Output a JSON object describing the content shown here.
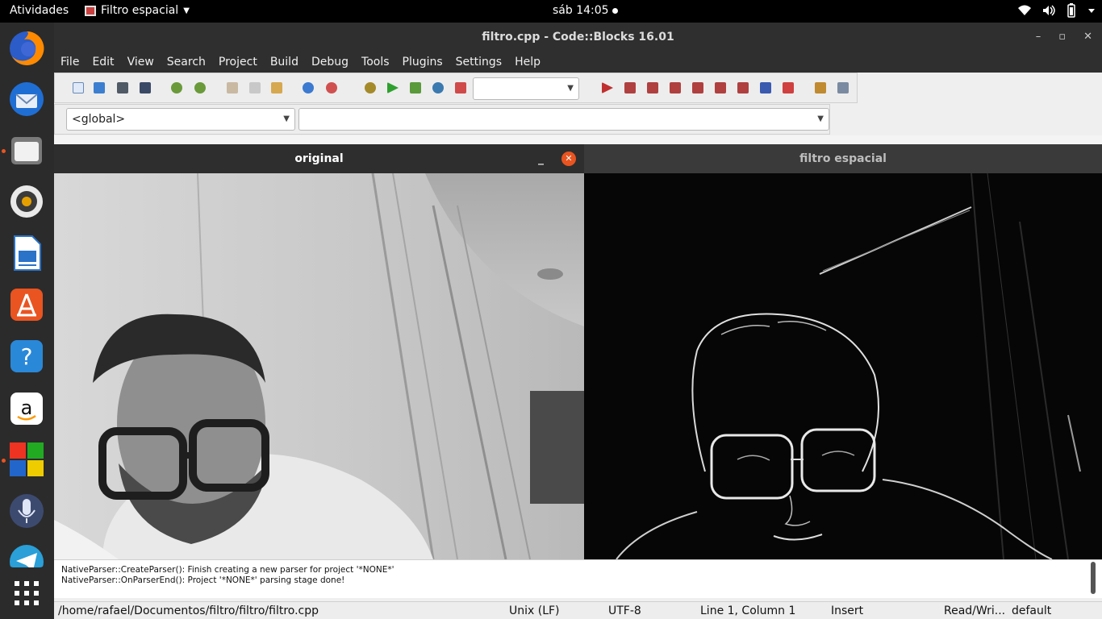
{
  "topbar": {
    "activities": "Atividades",
    "app_name": "Filtro espacial",
    "clock": "sáb 14:05"
  },
  "dock": {
    "items": [
      "firefox-icon",
      "thunderbird-icon",
      "files-icon",
      "rhythmbox-icon",
      "writer-icon",
      "software-icon",
      "help-icon",
      "amazon-icon",
      "codeblocks-icon",
      "voice-icon",
      "telegram-icon",
      "apps-grid-icon"
    ]
  },
  "codeblocks": {
    "title": "filtro.cpp - Code::Blocks 16.01",
    "menu": [
      "File",
      "Edit",
      "View",
      "Search",
      "Project",
      "Build",
      "Debug",
      "Tools",
      "Plugins",
      "Settings",
      "Help"
    ],
    "scope_combo": "<global>",
    "symbol_combo": "",
    "log_lines": [
      "NativeParser::CreateParser(): Finish creating a new parser for project '*NONE*'",
      "NativeParser::OnParserEnd(): Project '*NONE*' parsing stage done!"
    ],
    "status": {
      "path": "/home/rafael/Documentos/filtro/filtro/filtro.cpp",
      "eol": "Unix (LF)",
      "encoding": "UTF-8",
      "position": "Line 1, Column 1",
      "mode": "Insert",
      "access": "Read/Wri...",
      "lang": "default"
    }
  },
  "windows": {
    "original_title": "original",
    "filtered_title": "filtro espacial"
  },
  "colors": {
    "accent": "#e95420",
    "topbar": "#000000",
    "dock": "#2b2b2b"
  }
}
